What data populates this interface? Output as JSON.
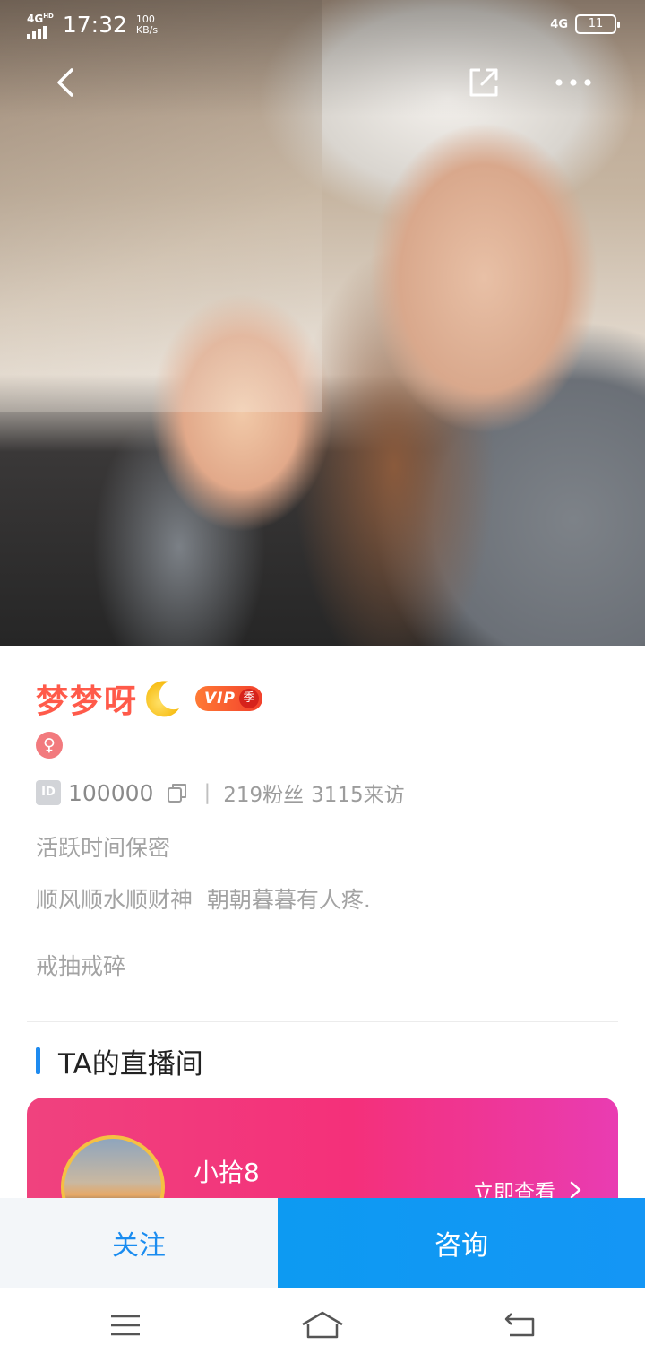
{
  "status_bar": {
    "network": "4G",
    "network_hd": "HD",
    "time": "17:32",
    "speed_value": "100",
    "speed_unit": "KB/s",
    "network_right": "4G",
    "battery": "11"
  },
  "nav": {
    "back_icon": "chevron-left-icon",
    "share_icon": "share-icon",
    "more_icon": "more-icon"
  },
  "profile": {
    "name": "梦梦呀",
    "name_emoji": "crescent-moon-icon",
    "vip_label": "VIP",
    "vip_season": "季",
    "gender_symbol": "♀",
    "id_label": "ID",
    "id_value": "100000",
    "separator": "|",
    "fans": "219粉丝",
    "visits": "3115来访",
    "active_time": "活跃时间保密",
    "signature_line1": "顺风顺水顺财神  朝朝暮暮有人疼.",
    "signature_line2": "戒抽戒碎"
  },
  "live_section": {
    "title": "TA的直播间",
    "room_name": "小拾8",
    "view_link": "立即查看"
  },
  "actions": {
    "follow": "关注",
    "consult": "咨询"
  },
  "colors": {
    "name": "#ff5a4a",
    "accent_blue": "#1a8cf0",
    "live_card": "#f0427e",
    "consult_bg": "#0d9af2"
  }
}
